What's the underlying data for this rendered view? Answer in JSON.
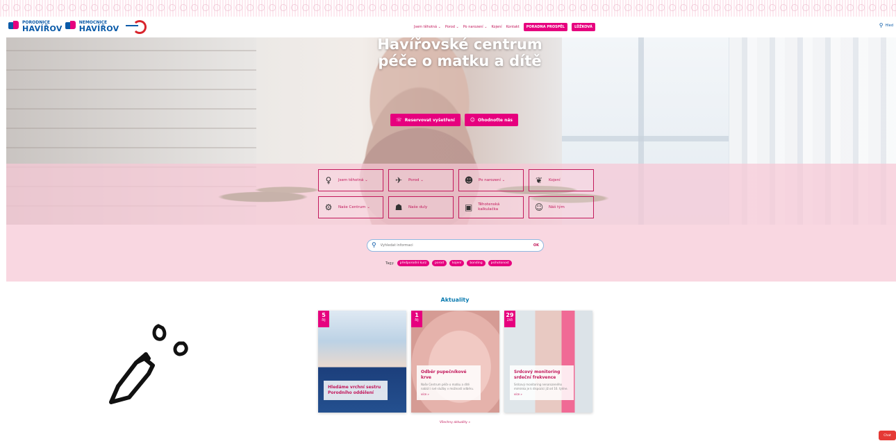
{
  "header": {
    "logo": {
      "left_small": "PORODNICE",
      "left_big": "HAVÍŘOV",
      "right_small": "NEMOCNICE",
      "right_big": "HAVÍŘOV"
    },
    "nav": [
      {
        "label": "Jsem těhotná ⌄"
      },
      {
        "label": "Porod ⌄"
      },
      {
        "label": "Po narození ⌄"
      },
      {
        "label": "Kojení"
      },
      {
        "label": "Kontakt"
      }
    ],
    "nav_pills": [
      {
        "label": "PORADNA PROSPĚL"
      },
      {
        "label": "LŮŽKOVÁ"
      }
    ],
    "search_label": "Hled"
  },
  "hero": {
    "title_line1": "Havířovské centrum",
    "title_line2": "péče o matku a dítě",
    "btn_reserve": "Reservovat vyšetření",
    "btn_rate": "Ohodnoťte nás"
  },
  "tiles": [
    {
      "label": "Jsem těhotná ⌄",
      "icon": "pregnant-icon"
    },
    {
      "label": "Porod ⌄",
      "icon": "stork-icon"
    },
    {
      "label": "Po narození ⌄",
      "icon": "baby-icon"
    },
    {
      "label": "Kojení",
      "icon": "breastfeeding-icon"
    },
    {
      "label": "Naše Centrum ⌄",
      "icon": "gear-icon"
    },
    {
      "label": "Naše duly",
      "icon": "doula-icon"
    },
    {
      "label": "Těhotenská kalkulačka",
      "icon": "calculator-icon"
    },
    {
      "label": "Náš tým",
      "icon": "team-icon"
    }
  ],
  "search": {
    "placeholder": "Vyhledat informaci",
    "ok": "OK",
    "tags_label": "Tagy:",
    "tags": [
      "předporodní kurz",
      "porod",
      "kojení",
      "bonding",
      "psihotonost"
    ]
  },
  "news": {
    "title": "Aktuality",
    "more": "Všechny aktuality »",
    "items": [
      {
        "day": "5",
        "month": "ŘÍJ",
        "title": "Hledáme vrchní sestru Porodního oddělení",
        "excerpt": "",
        "more": ""
      },
      {
        "day": "1",
        "month": "ŘÍJ",
        "title": "Odběr pupečníkové krve",
        "excerpt": "Naše Centrum péče o matku a dítě nabízí i své služby v možnosti odběru.",
        "more": "více »"
      },
      {
        "day": "29",
        "month": "ZÁŘ",
        "title": "Srdcový monitoring srdeční frekvence",
        "excerpt": "Srdcový monitoring nenarozeného miminka je k dispozici již od 16. týdne.",
        "more": "více »"
      }
    ]
  },
  "chat": {
    "label": "Chat"
  },
  "colors": {
    "accent": "#e6007e",
    "brand_blue": "#0a5aa8",
    "band_pink": "#f6c8d6"
  }
}
